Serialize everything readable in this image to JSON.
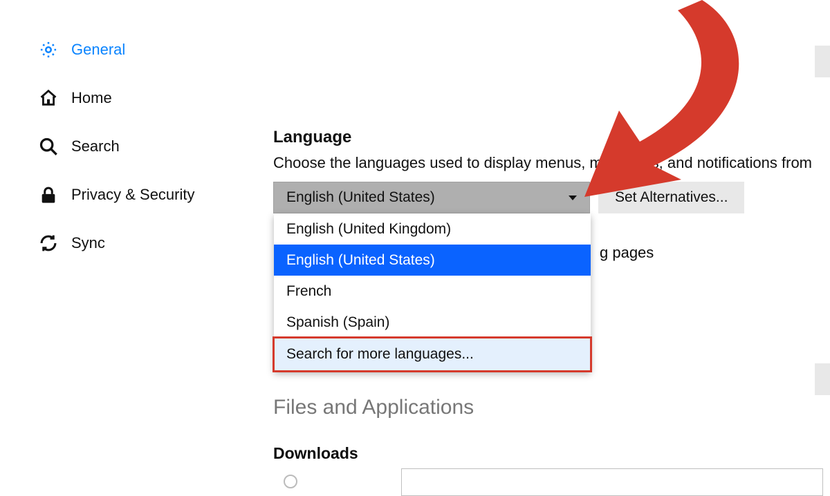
{
  "sidebar": {
    "items": [
      {
        "label": "General"
      },
      {
        "label": "Home"
      },
      {
        "label": "Search"
      },
      {
        "label": "Privacy & Security"
      },
      {
        "label": "Sync"
      }
    ]
  },
  "language": {
    "title": "Language",
    "desc": "Choose the languages used to display menus, messages, and notifications from",
    "selected": "English (United States)",
    "options": [
      "English (United Kingdom)",
      "English (United States)",
      "French",
      "Spanish (Spain)",
      "Search for more languages..."
    ],
    "set_alt_label": "Set Alternatives...",
    "partial_pages_text": "g pages"
  },
  "files_section_title": "Files and Applications",
  "downloads_title": "Downloads"
}
